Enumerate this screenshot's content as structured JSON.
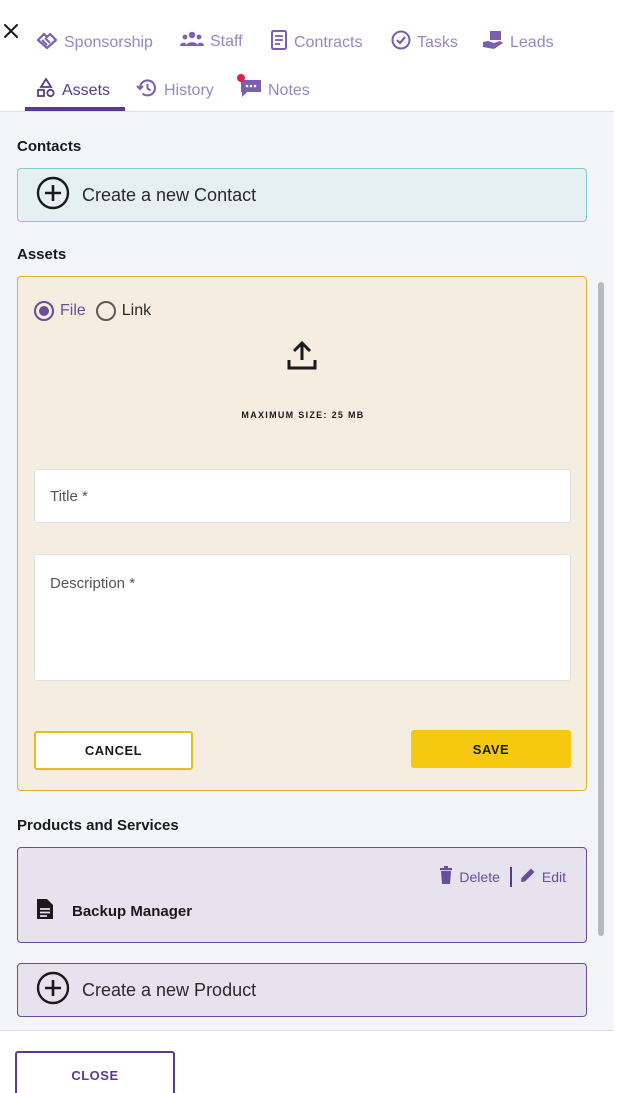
{
  "header": {
    "tabs": [
      {
        "label": "Sponsorship",
        "icon": "handshake-icon"
      },
      {
        "label": "Staff",
        "icon": "people-icon"
      },
      {
        "label": "Contracts",
        "icon": "contract-icon"
      },
      {
        "label": "Tasks",
        "icon": "check-circle-icon"
      },
      {
        "label": "Leads",
        "icon": "hand-box-icon"
      },
      {
        "label": "Assets",
        "icon": "shapes-icon"
      },
      {
        "label": "History",
        "icon": "history-icon"
      },
      {
        "label": "Notes",
        "icon": "chat-icon"
      }
    ],
    "active_tab": "Assets"
  },
  "contacts": {
    "section_title": "Contacts",
    "create_label": "Create a new Contact"
  },
  "assets": {
    "section_title": "Assets",
    "type_options": [
      "File",
      "Link"
    ],
    "selected_type": "File",
    "max_size_text": "MAXIMUM SIZE: 25 MB",
    "title_placeholder": "Title *",
    "description_placeholder": "Description *",
    "cancel_label": "CANCEL",
    "save_label": "SAVE"
  },
  "products": {
    "section_title": "Products and Services",
    "delete_label": "Delete",
    "edit_label": "Edit",
    "items": [
      {
        "name": "Backup Manager"
      }
    ],
    "create_label": "Create a new Product"
  },
  "footer": {
    "close_label": "CLOSE"
  },
  "colors": {
    "brand_purple": "#5a3a8e",
    "accent_yellow": "#f6c910",
    "contact_bg": "#e6eff1",
    "assets_bg": "#f5eee0",
    "product_bg": "#e6e2ee"
  }
}
